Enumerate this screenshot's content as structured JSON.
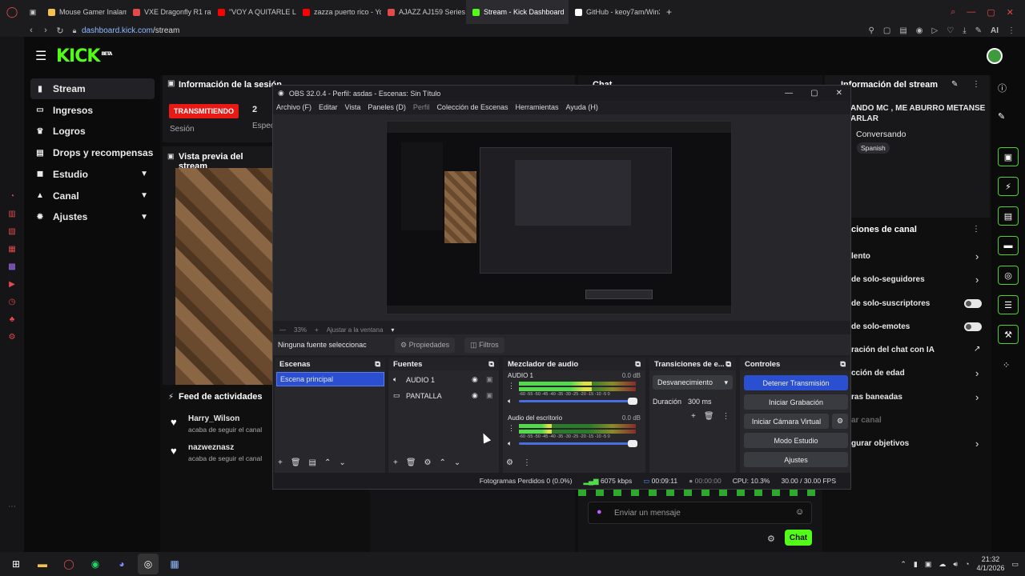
{
  "browser": {
    "tabs": [
      {
        "label": "Mouse Gamer Inalambrico",
        "color": "#f2c14e"
      },
      {
        "label": "VXE Dragonfly R1 ratón ina",
        "color": "#e34a4a"
      },
      {
        "label": "\"VOY A QUITARLE LOS HU",
        "color": "#ff0000"
      },
      {
        "label": "zazza puerto rico - YouTu",
        "color": "#ff0000"
      },
      {
        "label": "AJAZZ AJ159 Series Drive",
        "color": "#e34a4a"
      },
      {
        "label": "Stream - Kick Dashboard",
        "color": "#53fc18"
      },
      {
        "label": "GitHub - keoy7am/Win32P",
        "color": "#ffffff"
      }
    ],
    "url_host": "dashboard.kick.com",
    "url_path": "/stream",
    "ai_label": "AI"
  },
  "kick": {
    "logo": "KICK",
    "logo_sup": "BETA",
    "nav": [
      {
        "label": "Stream",
        "icon": "stream-icon",
        "glyph": "▮",
        "active": true
      },
      {
        "label": "Ingresos",
        "icon": "money-icon",
        "glyph": "▭"
      },
      {
        "label": "Logros",
        "icon": "trophy-icon",
        "glyph": "♛"
      },
      {
        "label": "Drops y recompensas",
        "icon": "gift-icon",
        "glyph": "▤"
      },
      {
        "label": "Estudio",
        "icon": "studio-icon",
        "glyph": "◼",
        "chevron": true
      },
      {
        "label": "Canal",
        "icon": "channel-icon",
        "glyph": "▲",
        "chevron": true
      },
      {
        "label": "Ajustes",
        "icon": "gear-icon",
        "glyph": "✹",
        "chevron": true
      }
    ],
    "stream_info": {
      "title": "Información de la sesión",
      "live": "TRANSMITIENDO",
      "session_label": "Sesión",
      "count": "2",
      "spec": "Espec"
    },
    "preview_title": "Vista previa del stream",
    "activity": {
      "title": "Feed de actividades",
      "items": [
        {
          "user": "Harry_Wilson",
          "text": "acaba de seguir el canal"
        },
        {
          "user": "nazweznasz",
          "text": "acaba de seguir el canal"
        }
      ]
    },
    "chat": {
      "title": "Chat",
      "placeholder": "Enviar un mensaje",
      "send": "Chat"
    },
    "stream_panel": {
      "title": "Información del stream",
      "stream_title": "ANDO MC , ME ABURRO METANSE\nARLAR",
      "category": "Conversando",
      "language": "Spanish"
    },
    "channel_actions": {
      "title": "ciones de canal",
      "items": [
        {
          "label": "lento",
          "control": "chevron"
        },
        {
          "label": "de solo-seguidores",
          "control": "chevron"
        },
        {
          "label": "de solo-suscriptores",
          "control": "toggle"
        },
        {
          "label": "de solo-emotes",
          "control": "toggle"
        },
        {
          "label": "ración del chat con IA",
          "control": "external"
        },
        {
          "label": "cción de edad",
          "control": "chevron"
        },
        {
          "label": "ras baneadas",
          "control": "chevron"
        },
        {
          "label": "ar canal",
          "control": "none"
        },
        {
          "label": "gurar objetivos",
          "control": "chevron"
        }
      ]
    }
  },
  "obs": {
    "title": "OBS 32.0.4 - Perfil: asdas - Escenas: Sin Título",
    "menu": [
      "Archivo (F)",
      "Editar",
      "Vista",
      "Paneles (D)",
      "Perfil",
      "Colección de Escenas",
      "Herramientas",
      "Ayuda (H)"
    ],
    "zoom": "33%",
    "fit": "Ajustar a la ventana",
    "no_source": "Ninguna fuente seleccionac",
    "properties": "Propiedades",
    "filters": "Filtros",
    "scenes": {
      "title": "Escenas",
      "items": [
        "Escena principal"
      ]
    },
    "sources": {
      "title": "Fuentes",
      "items": [
        {
          "label": "AUDIO 1",
          "icon": "speaker-icon"
        },
        {
          "label": "PANTALLA",
          "icon": "monitor-icon"
        }
      ]
    },
    "mixer": {
      "title": "Mezclador de audio",
      "channels": [
        {
          "name": "AUDIO 1",
          "db": "0.0 dB",
          "level": 0.62
        },
        {
          "name": "Audio del escritorio",
          "db": "0.0 dB",
          "level": 0.28
        }
      ],
      "scale": "-60 -55 -50 -45 -40 -35 -30 -25 -20 -15 -10 -5 0"
    },
    "transitions": {
      "title": "Transiciones de e...",
      "type": "Desvanecimiento",
      "duration_label": "Duración",
      "duration": "300 ms"
    },
    "controls": {
      "title": "Controles",
      "buttons": [
        "Detener Transmisión",
        "Iniciar Grabación",
        "Iniciar Cámara Virtual",
        "Modo Estudio",
        "Ajustes"
      ]
    },
    "status": {
      "dropped": "Fotogramas Perdidos 0 (0.0%)",
      "bitrate": "6075 kbps",
      "stream_time": "00:09:11",
      "rec_time": "00:00:00",
      "cpu": "CPU: 10.3%",
      "fps": "30.00 / 30.00 FPS"
    }
  },
  "taskbar": {
    "time": "21:32",
    "date": "4/1/2026"
  }
}
